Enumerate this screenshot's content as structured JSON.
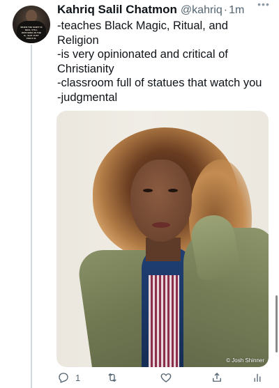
{
  "tweet": {
    "display_name": "Kahriq Salil Chatmon",
    "handle": "@kahriq",
    "separator": "·",
    "time": "1m",
    "more_icon": "ellipsis-icon",
    "text_lines": [
      "-teaches Black Magic, Ritual, and",
      "Religion",
      "-is very opinionated and critical of",
      "Christianity",
      "-classroom full of statues that watch you",
      "-judgmental"
    ],
    "avatar_text": "WHEN THE SHIRT IS NICE, STILL WATCHING IN THE B., SHIT JUST FEELS B."
  },
  "media": {
    "credit": "© Josh Shinner"
  },
  "actions": {
    "reply_icon": "reply-icon",
    "reply_count": "1",
    "retweet_icon": "retweet-icon",
    "like_icon": "heart-icon",
    "share_icon": "share-icon",
    "analytics_icon": "analytics-icon"
  },
  "colors": {
    "text": "#0f1419",
    "secondary": "#536471",
    "thread_line": "#cfd9de"
  }
}
